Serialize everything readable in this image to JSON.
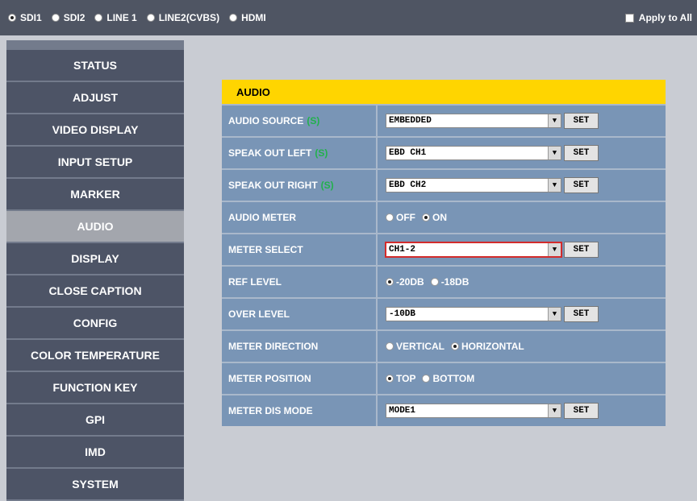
{
  "top_bar": {
    "sources": [
      {
        "label": "SDI1",
        "selected": true
      },
      {
        "label": "SDI2",
        "selected": false
      },
      {
        "label": "LINE 1",
        "selected": false
      },
      {
        "label": "LINE2(CVBS)",
        "selected": false
      },
      {
        "label": "HDMI",
        "selected": false
      }
    ],
    "apply_all_label": "Apply to All"
  },
  "sidebar": {
    "items": [
      {
        "label": "STATUS"
      },
      {
        "label": "ADJUST"
      },
      {
        "label": "VIDEO DISPLAY"
      },
      {
        "label": "INPUT SETUP"
      },
      {
        "label": "MARKER"
      },
      {
        "label": "AUDIO",
        "active": true
      },
      {
        "label": "DISPLAY"
      },
      {
        "label": "CLOSE CAPTION"
      },
      {
        "label": "CONFIG"
      },
      {
        "label": "COLOR TEMPERATURE"
      },
      {
        "label": "FUNCTION KEY"
      },
      {
        "label": "GPI"
      },
      {
        "label": "IMD"
      },
      {
        "label": "SYSTEM"
      }
    ]
  },
  "panel": {
    "title": "AUDIO",
    "set_label": "SET",
    "s_marker": "(S)",
    "rows": {
      "audio_source": {
        "label": "AUDIO SOURCE",
        "value": "EMBEDDED"
      },
      "speak_left": {
        "label": "SPEAK OUT LEFT",
        "value": "EBD CH1"
      },
      "speak_right": {
        "label": "SPEAK OUT RIGHT",
        "value": "EBD CH2"
      },
      "audio_meter": {
        "label": "AUDIO METER",
        "options": [
          "OFF",
          "ON"
        ],
        "selected": "ON"
      },
      "meter_select": {
        "label": "METER SELECT",
        "value": "CH1-2"
      },
      "ref_level": {
        "label": "REF LEVEL",
        "options": [
          "-20DB",
          "-18DB"
        ],
        "selected": "-20DB"
      },
      "over_level": {
        "label": "OVER LEVEL",
        "value": "-10DB"
      },
      "meter_direction": {
        "label": "METER DIRECTION",
        "options": [
          "VERTICAL",
          "HORIZONTAL"
        ],
        "selected": "HORIZONTAL"
      },
      "meter_position": {
        "label": "METER POSITION",
        "options": [
          "TOP",
          "BOTTOM"
        ],
        "selected": "TOP"
      },
      "meter_dis_mode": {
        "label": "METER DIS MODE",
        "value": "MODE1"
      }
    }
  }
}
